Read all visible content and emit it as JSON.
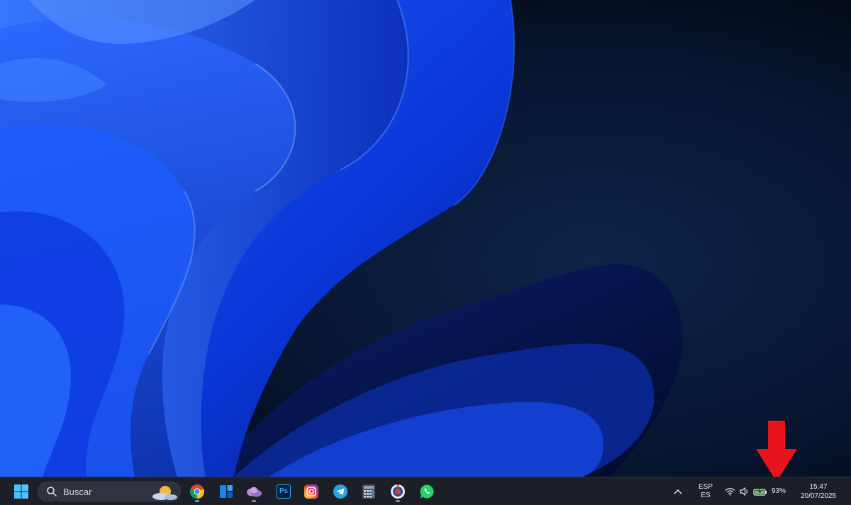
{
  "taskbar": {
    "search_placeholder": "Buscar",
    "pinned_apps": [
      "Chrome",
      "Widgets",
      "OneDrive",
      "Photoshop",
      "Instagram",
      "Telegram",
      "Calculator",
      "Recorder",
      "WhatsApp"
    ],
    "photoshop_glyph": "Ps"
  },
  "tray": {
    "language_top": "ESP",
    "language_bottom": "ES",
    "battery_percent": "93%",
    "time": "15:47",
    "date": "20/07/2025"
  },
  "colors": {
    "taskbar_bg": "#1c1f27",
    "annotation_arrow": "#e8141c",
    "battery_green": "#6ccb5f"
  },
  "icons": [
    "windows-start-icon",
    "search-icon",
    "weather-icon",
    "chevron-up-icon",
    "wifi-icon",
    "volume-icon",
    "battery-icon"
  ]
}
